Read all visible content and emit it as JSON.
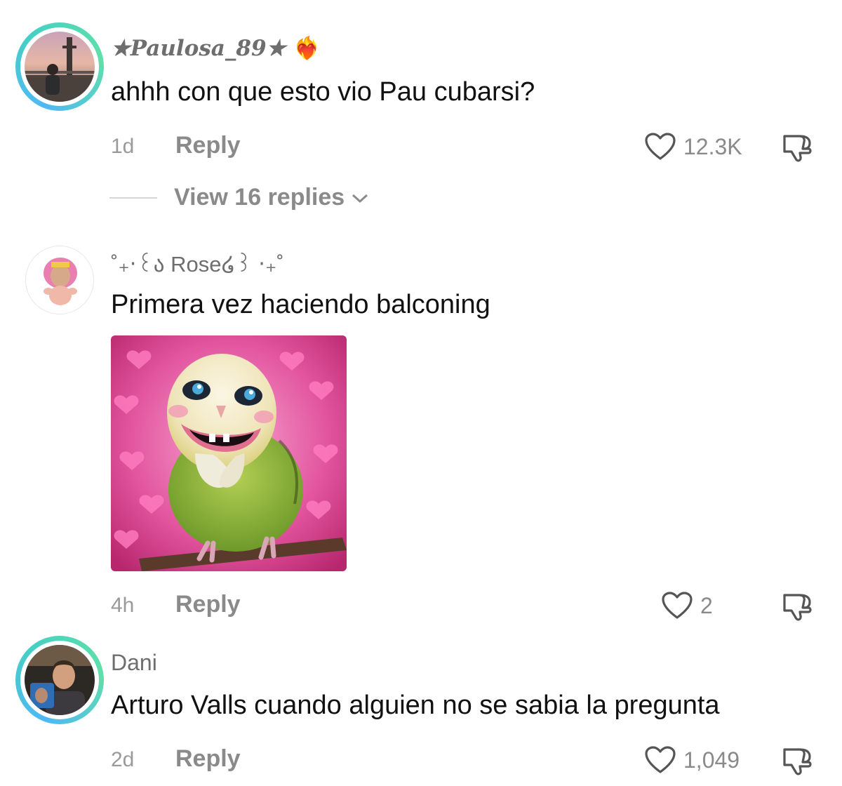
{
  "comments": [
    {
      "username": "★Paulosa_89★",
      "user_badge": "❤️‍🔥",
      "text": "ahhh con que esto vio Pau cubarsi?",
      "time": "1d",
      "reply_label": "Reply",
      "likes": "12.3K",
      "view_replies": "View 16 replies"
    },
    {
      "username": "˚₊‧꒰ა Rose໒꒱ ‧₊˚",
      "text": "Primera vez haciendo balconing",
      "time": "4h",
      "reply_label": "Reply",
      "likes": "2"
    },
    {
      "username": "Dani",
      "text": "Arturo Valls cuando alguien no se sabia la pregunta",
      "time": "2d",
      "reply_label": "Reply",
      "likes": "1,049"
    }
  ],
  "colors": {
    "story_ring": "#4fb8f5",
    "secondary_text": "#8a8a8a",
    "primary_text": "#111111"
  },
  "icons": [
    "heart-outline-icon",
    "thumbs-down-icon",
    "chevron-down-icon"
  ]
}
